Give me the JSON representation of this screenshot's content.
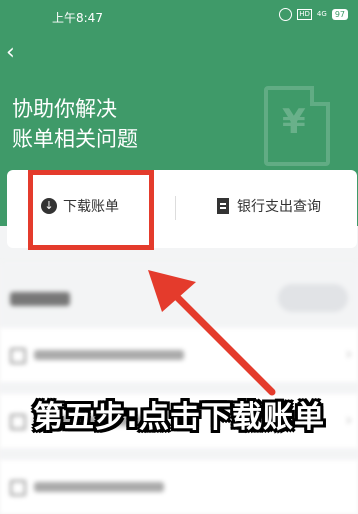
{
  "status_bar": {
    "time": "上午8:47",
    "battery": "97"
  },
  "header": {
    "title_line1": "协助你解决",
    "title_line2": "账单相关问题"
  },
  "actions": {
    "download_label": "下载账单",
    "query_label": "银行支出查询"
  },
  "caption": "第五步:点击下载账单",
  "colors": {
    "header_green": "#3f9a69",
    "highlight_red": "#e43b2c",
    "page_bg": "#f3f4f5"
  }
}
